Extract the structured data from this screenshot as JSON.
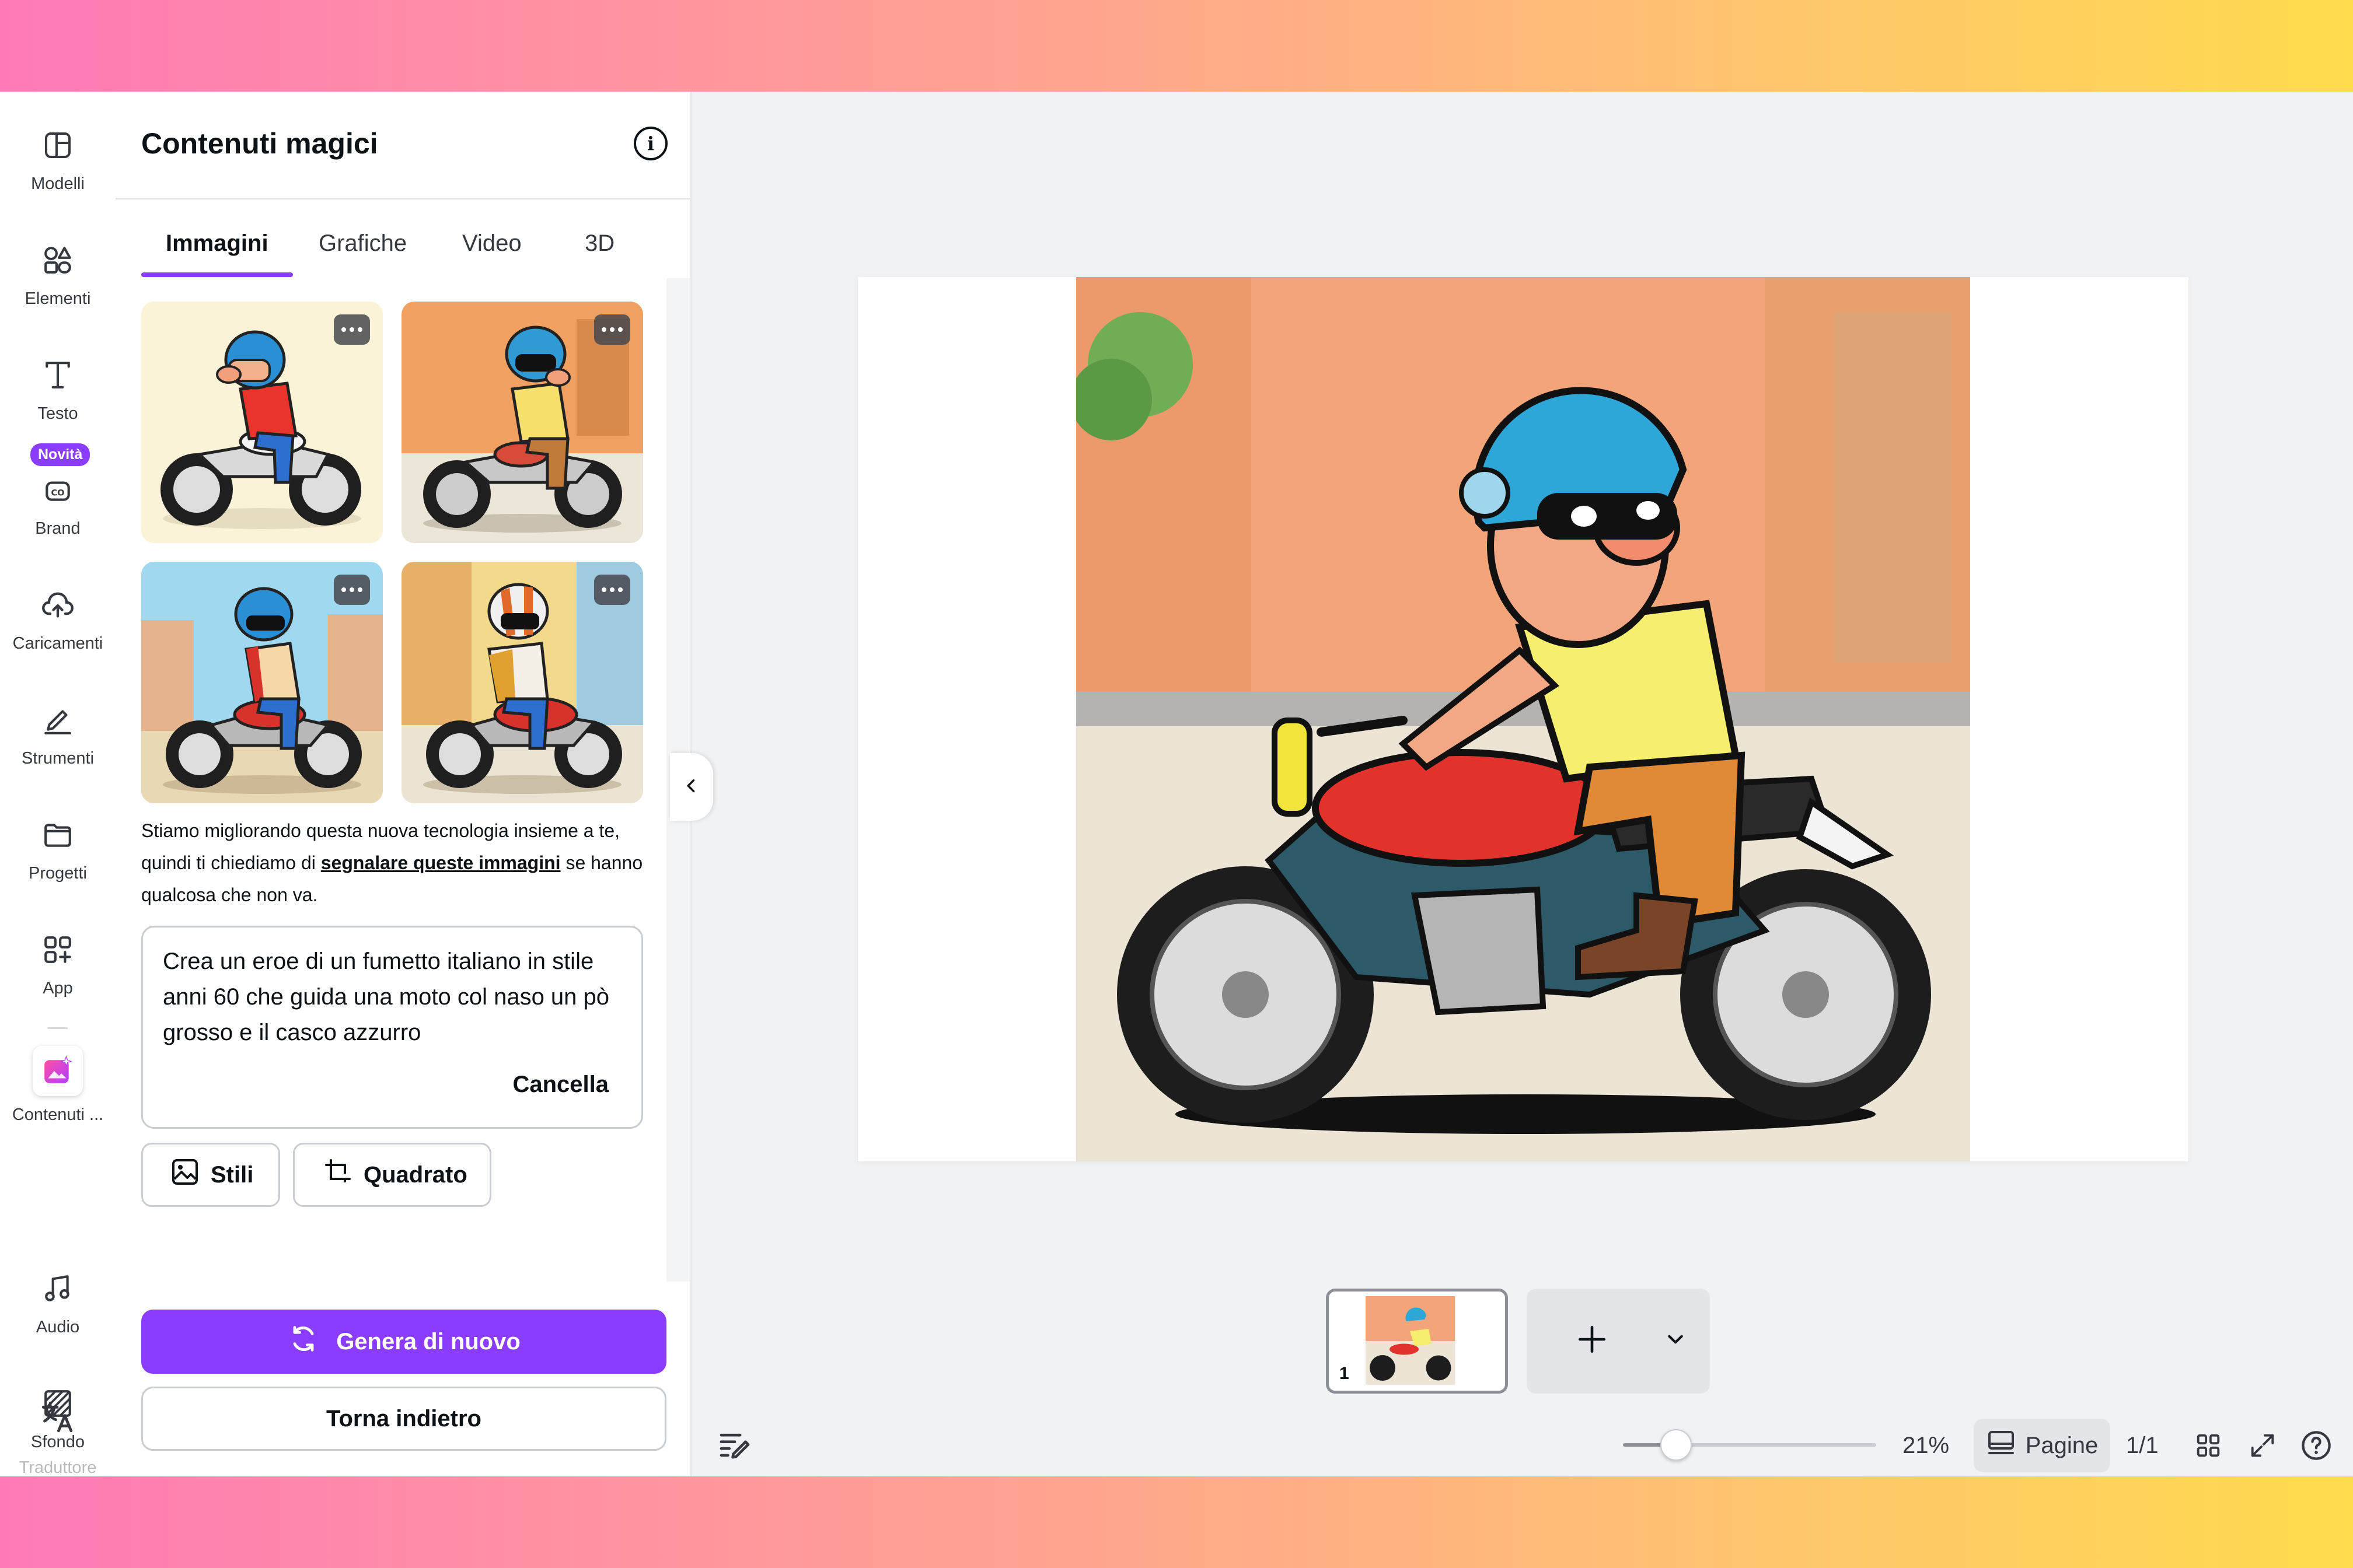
{
  "colors": {
    "brand_purple": "#8b3dff",
    "band_gradient": [
      "#ff7ab6",
      "#ffdb4d"
    ],
    "canvas_bg": "#f1f2f5"
  },
  "rail": {
    "items": [
      {
        "label": "Modelli",
        "icon": "layout-icon"
      },
      {
        "label": "Elementi",
        "icon": "shapes-icon"
      },
      {
        "label": "Testo",
        "icon": "text-icon"
      },
      {
        "label": "Brand",
        "icon": "brand-icon"
      },
      {
        "label": "Caricamenti",
        "icon": "cloud-upload-icon"
      },
      {
        "label": "Strumenti",
        "icon": "pen-icon"
      },
      {
        "label": "Progetti",
        "icon": "folder-icon"
      },
      {
        "label": "App",
        "icon": "apps-icon"
      },
      {
        "label": "Contenuti ...",
        "icon": "magic-media-icon"
      },
      {
        "label": "Audio",
        "icon": "music-note-icon"
      },
      {
        "label": "Sfondo",
        "icon": "background-pattern-icon"
      },
      {
        "label": "Traduttore",
        "icon": "translate-icon"
      }
    ],
    "new_badge": "Novità"
  },
  "panel": {
    "title": "Contenuti magici",
    "tabs": [
      {
        "label": "Immagini",
        "active": true
      },
      {
        "label": "Grafiche",
        "active": false
      },
      {
        "label": "Video",
        "active": false
      },
      {
        "label": "3D",
        "active": false
      }
    ],
    "notice": {
      "before": "Stiamo migliorando questa nuova tecnologia insieme a te, quindi ti chiediamo di ",
      "link": "segnalare queste immagini",
      "after": " se hanno qualcosa che non va."
    },
    "prompt": "Crea un eroe di un fumetto italiano in stile anni 60 che guida una moto col naso un pò grosso e il casco azzurro",
    "clear_label": "Cancella",
    "style_chip": "Stili",
    "ratio_chip": "Quadrato",
    "generate_label": "Genera di nuovo",
    "back_label": "Torna indietro"
  },
  "canvas": {
    "page_number": "1"
  },
  "footer": {
    "zoom_level": "21%",
    "zoom_fraction": 0.21,
    "pages_label": "Pagine",
    "page_count": "1/1"
  }
}
